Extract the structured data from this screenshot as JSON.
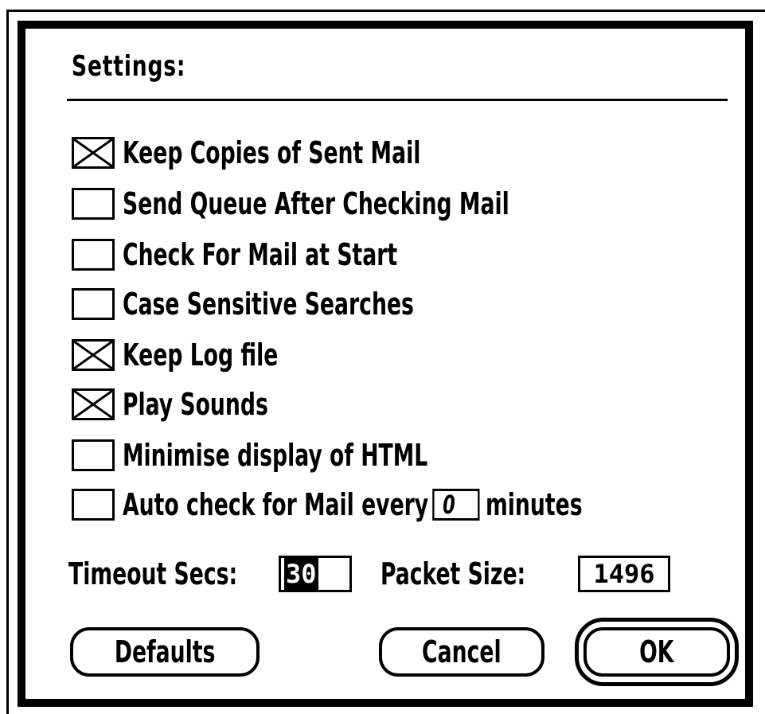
{
  "dialog": {
    "title": "Settings:"
  },
  "options": [
    {
      "label": "Keep Copies of Sent Mail",
      "checked": true
    },
    {
      "label": "Send Queue After Checking Mail",
      "checked": false
    },
    {
      "label": "Check For Mail at Start",
      "checked": false
    },
    {
      "label": "Case Sensitive Searches",
      "checked": false
    },
    {
      "label": "Keep Log file",
      "checked": true
    },
    {
      "label": "Play Sounds",
      "checked": true
    },
    {
      "label": "Minimise display of HTML",
      "checked": false
    }
  ],
  "auto_check": {
    "label_prefix": "Auto check for Mail every",
    "value": "0",
    "label_suffix": "minutes",
    "checked": false
  },
  "timeout": {
    "label": "Timeout Secs:",
    "value": "30"
  },
  "packet_size": {
    "label": "Packet Size:",
    "value": "1496"
  },
  "buttons": {
    "defaults": "Defaults",
    "cancel": "Cancel",
    "ok": "OK"
  }
}
